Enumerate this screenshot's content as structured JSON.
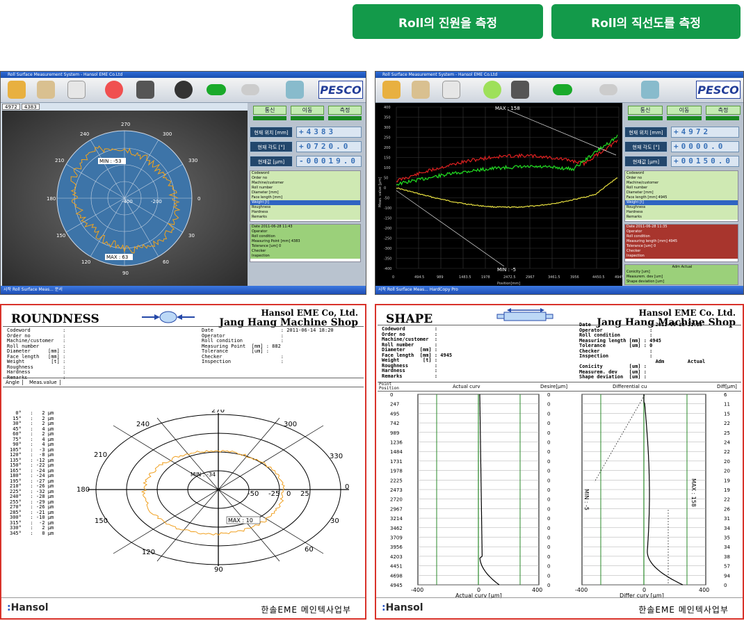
{
  "buttons": {
    "roundness": "Roll의 진원을 측정",
    "straightness": "Roll의 직선도를 측정"
  },
  "left_app": {
    "title": "Roll Surface Measurement System - Hansol EME Co.Ltd",
    "pos_readout": [
      "4972",
      "4383"
    ],
    "panel_buttons": [
      "통신",
      "이동",
      "측정"
    ],
    "pos_label": "현재 위치 [mm]",
    "pos_value": "+4383",
    "angle_label": "현재 각도 [°]",
    "angle_value": "+0720.0",
    "meas_label": "현재값 [µm]",
    "meas_value": "-00019.0",
    "fields": [
      "Codeword",
      "Order no",
      "Machine/customer",
      "Roll number",
      "Diameter [mm]",
      "Face length [mm]",
      "Weight [t]",
      "Roughness",
      "Hardness",
      "Remarks"
    ],
    "info": [
      "Date 2011-06-28 11:43",
      "Operator",
      "Roll condition",
      "Measuring Point [mm] 4383",
      "Tolerance [um] 0",
      "Checker",
      "Inspection"
    ],
    "polar": {
      "min": "MIN : -53",
      "max": "MAX : 63",
      "angles": [
        "270",
        "300",
        "330",
        "0",
        "30",
        "60",
        "90",
        "120",
        "150",
        "180",
        "210",
        "240"
      ],
      "radii": [
        "-400",
        "-200"
      ]
    },
    "taskbar": "시작   Roll Surface Meas...   문서"
  },
  "right_app": {
    "title": "Roll Surface Measurement System - Hansol EME Co.Ltd",
    "panel_buttons": [
      "통신",
      "이동",
      "측정"
    ],
    "pos_label": "현재 위치 [mm]",
    "pos_value": "+4972",
    "angle_label": "현재 각도 [°]",
    "angle_value": "+0000.0",
    "meas_label": "현재값 [µm]",
    "meas_value": "+00150.0",
    "fields": [
      "Codeword",
      "Order no",
      "Machine/customer",
      "Roll number",
      "Diameter [mm]",
      "Face length [mm] 4945",
      "Weight [t]",
      "Roughness",
      "Hardness",
      "Remarks"
    ],
    "info": [
      "Date 2011-06-28 11:35",
      "Operator",
      "Roll condition",
      "Measuring length [mm] 4945",
      "Tolerance [um] 0",
      "Checker",
      "Inspection"
    ],
    "extra": [
      "Conicity [um]",
      "Measurem. dev [um]",
      "Shape deviation [um]"
    ],
    "adm": "Adm",
    "actual": "Actual",
    "chart": {
      "max": "MAX : 158",
      "min": "MIN : -5",
      "ylabel": "Meas. value [µm]",
      "xlabel": "Position[mm]",
      "yticks": [
        "400",
        "350",
        "300",
        "250",
        "200",
        "150",
        "100",
        "50",
        "0",
        "-50",
        "-100",
        "-150",
        "-200",
        "-250",
        "-300",
        "-350",
        "-400"
      ],
      "xticks": [
        "0",
        "494.5",
        "989",
        "1483.5",
        "1978",
        "2472.5",
        "2967",
        "3461.5",
        "3956",
        "4450.5",
        "4945"
      ]
    },
    "taskbar": "시작   Roll Surface Meas...   HardCopy Pro"
  },
  "roundness": {
    "title": "ROUNDNESS",
    "company": "Hansol EME Co, Ltd.",
    "shop": "Jang Hang Machine Shop",
    "left_fields": "Codeword           :\nOrder no           :\nMachine/customer   :\nRoll number        :\nDiameter      [mm] :\nFace length   [mm] :\nWeight         [t] :\nRoughness          :\nHardness           :\nRemarks            :",
    "right_fields": "Date                       : 2011-06-14 18:20\nOperator                   :\nRoll condition             :\nMeasuring Point  [mm] : 882\nTolerance        [um] :\nChecker                    :\nInspection                 :",
    "col_angle": "Angle",
    "col_meas": "Meas.value",
    "values": "  0°   :   2 µm\n 15°   :   2 µm\n 30°   :   2 µm\n 45°   :   4 µm\n 60°   :   2 µm\n 75°   :   4 µm\n 90°   :   4 µm\n105°   :  -3 µm\n120°   :  -8 µm\n135°   : -12 µm\n150°   : -22 µm\n165°   : -24 µm\n180°   : -24 µm\n195°   : -27 µm\n210°   : -26 µm\n225°   : -32 µm\n240°   : -28 µm\n255°   : -29 µm\n270°   : -26 µm\n285°   : -21 µm\n300°   : -10 µm\n315°   :  -2 µm\n330°   :   2 µm\n345°   :   0 µm",
    "polar": {
      "min": "MIN : -34",
      "max": "MAX : 10",
      "angles": [
        "270",
        "300",
        "330",
        "0",
        "30",
        "60",
        "90",
        "120",
        "150",
        "180",
        "210",
        "240"
      ],
      "radii": [
        "-50",
        "-25",
        "0",
        "25"
      ]
    },
    "footer_logo": "Hansol",
    "footer_text": "한솔EME 메인텍사업부"
  },
  "shape": {
    "title": "SHAPE",
    "company": "Hansol EME Co. Ltd.",
    "shop": "Jang Hang Machine Shop",
    "left_fields": "Codeword          :\nOrder no          :\nMachine/customer  :\nRoll number       :\nDiameter     [mm] :\nFace length  [mm] : 4945\nWeight        [t] :\nRoughness         :\nHardness          :\nRemarks           :",
    "right_fields": "Date                    : 2011-06-28 11:35\nOperator                :\nRoll condition          :\nMeasuring length [mm] : 4945\nTolerance        [um] : 0\nChecker                 :\nInspection              :\n                          Adm        Actual\nConicity         [um] :\nMeasurem. dev    [um] :\nShape deviation  [um] :",
    "col_point": "Point\nPosition",
    "col_actual": "Actual curv",
    "col_desire": "Desire[µm]",
    "col_diff": "Differential cu",
    "col_diffv": "Diff[µm]",
    "positions": [
      "0",
      "247",
      "495",
      "742",
      "989",
      "1236",
      "1484",
      "1731",
      "1978",
      "2225",
      "2473",
      "2720",
      "2967",
      "3214",
      "3462",
      "3709",
      "3956",
      "4203",
      "4451",
      "4698",
      "4945"
    ],
    "desire": [
      "0",
      "0",
      "0",
      "0",
      "0",
      "0",
      "0",
      "0",
      "0",
      "0",
      "0",
      "0",
      "0",
      "0",
      "0",
      "0",
      "0",
      "0",
      "0",
      "0",
      "0"
    ],
    "diff": [
      "6",
      "11",
      "15",
      "22",
      "25",
      "24",
      "22",
      "20",
      "20",
      "19",
      "19",
      "22",
      "26",
      "31",
      "34",
      "35",
      "34",
      "38",
      "57",
      "94",
      "0"
    ],
    "axis_a": [
      "-400",
      "0",
      "400"
    ],
    "axis_b": [
      "-400",
      "0",
      "400"
    ],
    "xlabel_a": "Actual curv [µm]",
    "xlabel_b": "Differ curv [µm]",
    "min": "MIN : -5",
    "max": "MAX : 158",
    "footer_logo": "Hansol",
    "footer_text": "한솔EME 메인텍사업부"
  }
}
